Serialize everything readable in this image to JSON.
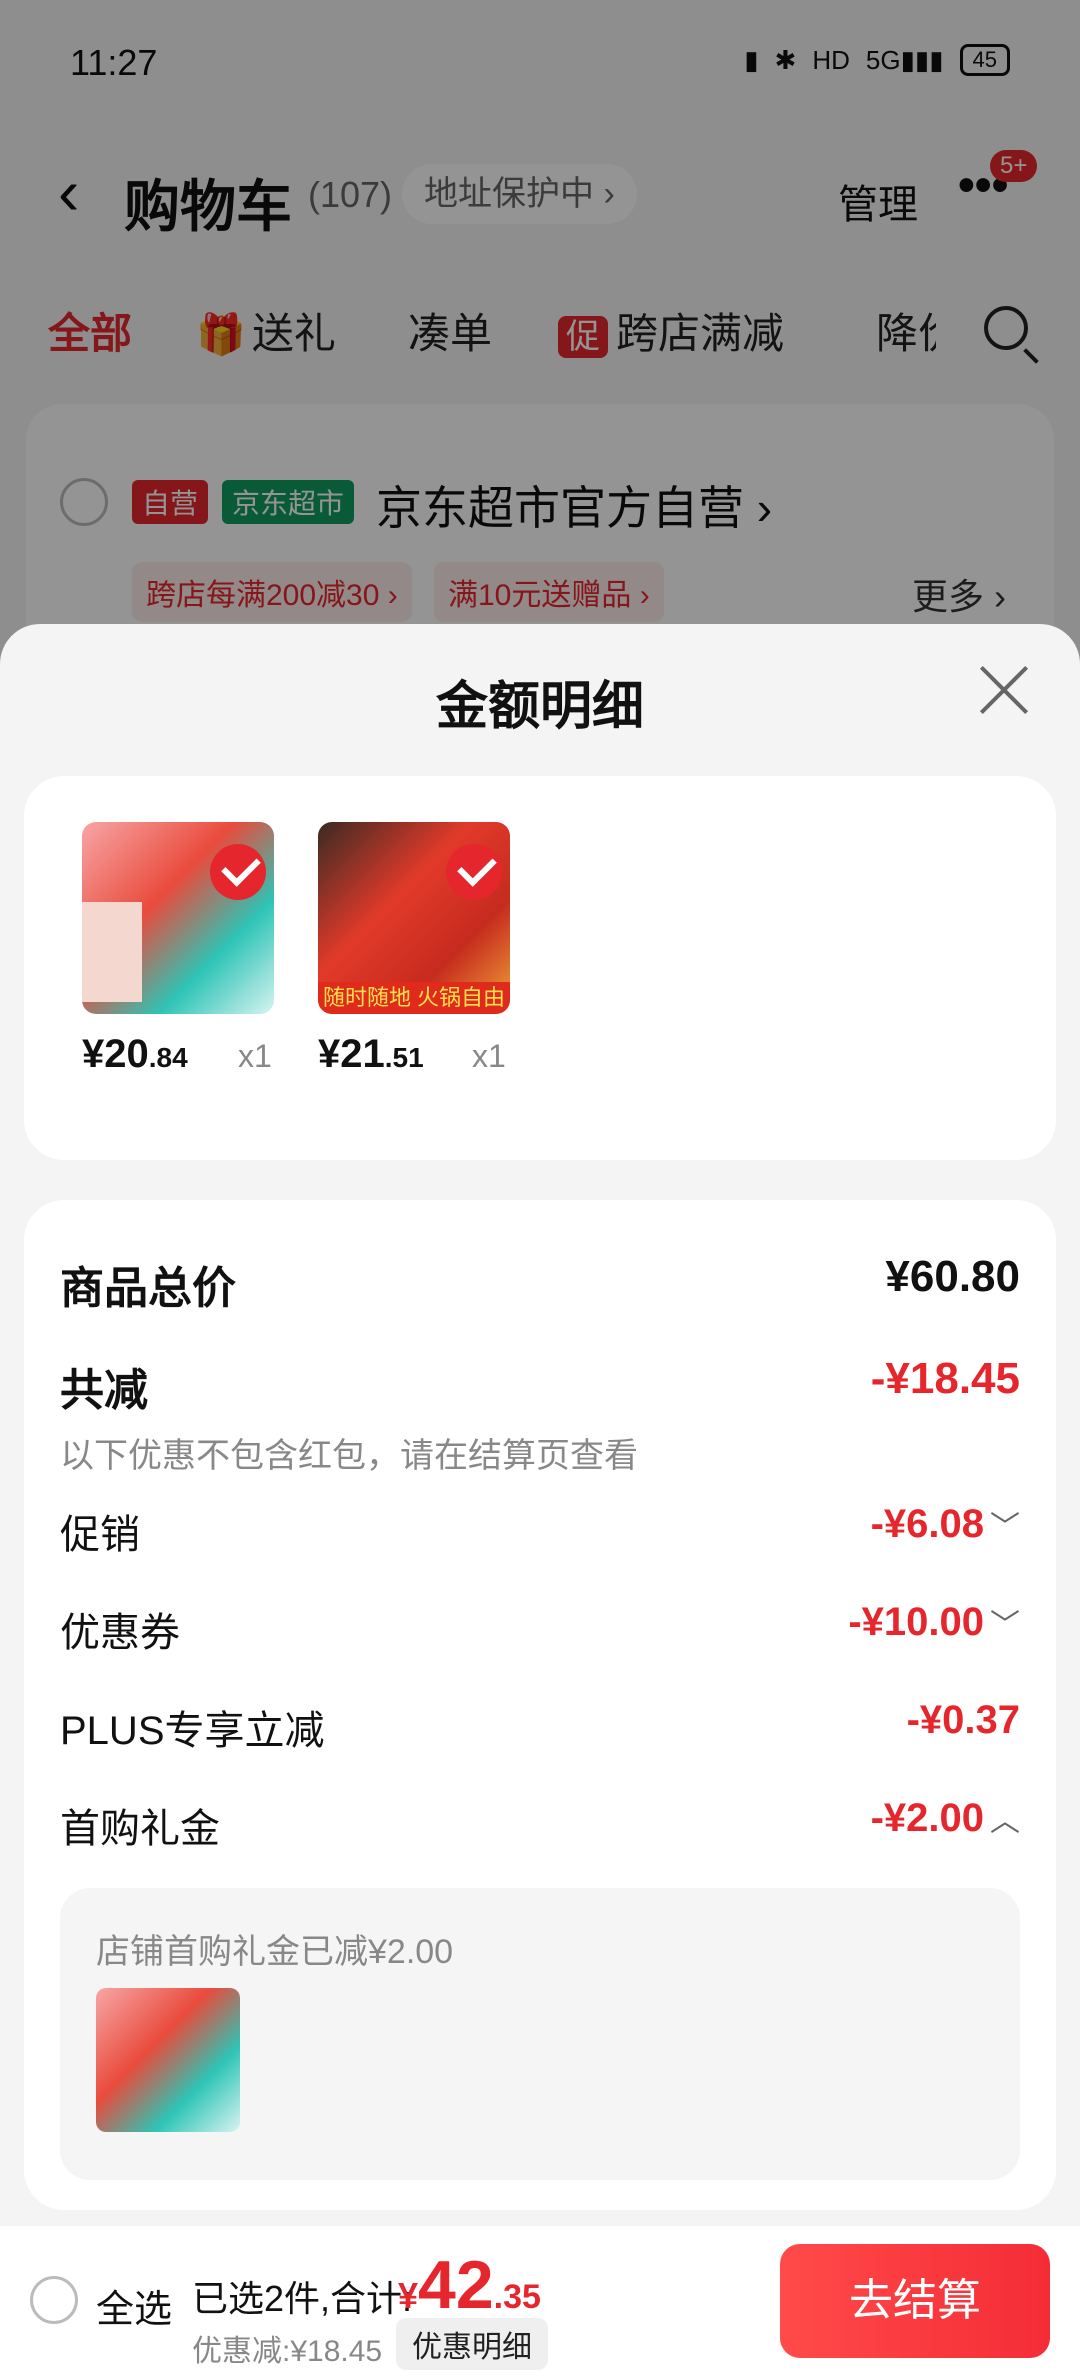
{
  "status": {
    "time": "11:27",
    "icons": [
      "vibrate-icon",
      "bluetooth-icon",
      "hd-icon",
      "5g-signal-icon"
    ],
    "battery": "45"
  },
  "nav": {
    "title": "购物车",
    "count": "(107)",
    "address_protect": "地址保护中 ›",
    "manage": "管理",
    "more": "•••",
    "badge": "5+"
  },
  "tabs": {
    "all": "全部",
    "gift": "送礼",
    "gift_icon": "🎁",
    "combine": "凑单",
    "promo_tag": "促",
    "cross_store": "跨店满减",
    "price_drop": "降价"
  },
  "store": {
    "tag_self": "自营",
    "tag_market": "京东超市",
    "name": "京东超市官方自营 ›",
    "promo1": "跨店每满200减30 ›",
    "promo2": "满10元送赠品 ›",
    "more": "更多 ›"
  },
  "sheet": {
    "title": "金额明细",
    "products": [
      {
        "price_int": "¥20",
        "price_dec": ".84",
        "qty": "x1",
        "banner": ""
      },
      {
        "price_int": "¥21",
        "price_dec": ".51",
        "qty": "x1",
        "banner": "随时随地 火锅自由"
      }
    ],
    "rows": {
      "total_label": "商品总价",
      "total_value": "¥60.80",
      "reduce_label": "共减",
      "reduce_value": "-¥18.45",
      "reduce_note": "以下优惠不包含红包，请在结算页查看",
      "promo_label": "促销",
      "promo_value": "-¥6.08",
      "coupon_label": "优惠券",
      "coupon_value": "-¥10.00",
      "plus_label": "PLUS专享立减",
      "plus_value": "-¥0.37",
      "first_label": "首购礼金",
      "first_value": "-¥2.00"
    },
    "gift_note": "店铺首购礼金已减¥2.00"
  },
  "bottom": {
    "select_all": "全选",
    "selected": "已选2件,合计:",
    "total_cur": "¥",
    "total_int": "42",
    "total_dec": ".35",
    "saved": "优惠减:¥18.45",
    "detail_button": "优惠明细",
    "checkout": "去结算"
  },
  "colors": {
    "accent": "#e5262d",
    "market_green": "#0f9e5e"
  }
}
